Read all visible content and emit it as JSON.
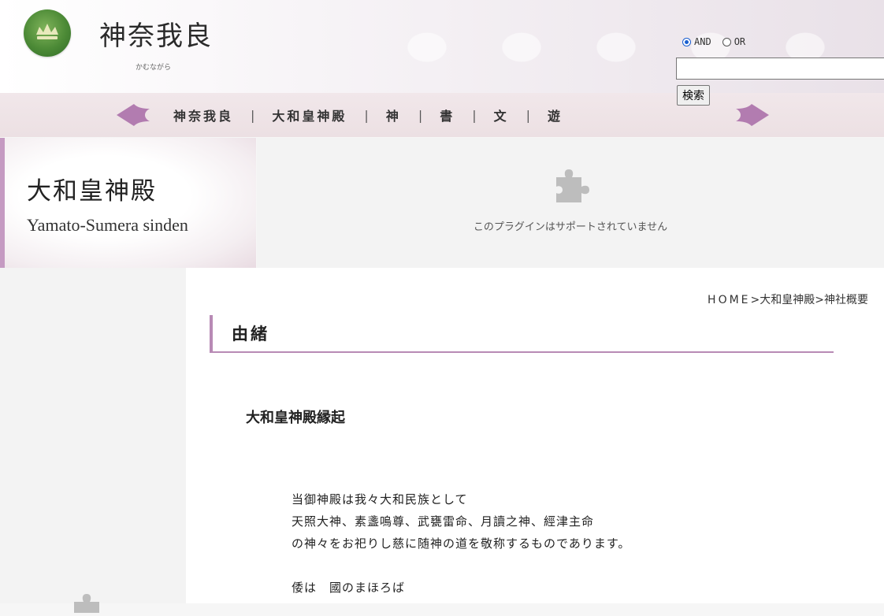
{
  "header": {
    "site_title": "神奈我良",
    "site_subtitle": "かむながら",
    "logo_icon": "crown-emblem-icon"
  },
  "search": {
    "options": [
      {
        "label": "AND",
        "checked": true
      },
      {
        "label": "OR",
        "checked": false
      }
    ],
    "input_value": "",
    "button_label": "検索"
  },
  "nav": {
    "items": [
      "神奈我良",
      "大和皇神殿",
      "神",
      "書",
      "文",
      "遊"
    ],
    "separator": "|",
    "left_arrow_icon": "arrow-left-icon",
    "right_arrow_icon": "arrow-right-icon"
  },
  "banner": {
    "title": "大和皇神殿",
    "subtitle": "Yamato-Sumera sinden",
    "plugin_message": "このプラグインはサポートされていません",
    "plugin_icon": "puzzle-piece-icon"
  },
  "colors": {
    "accent": "#b88ab5",
    "nav_bg": "#efe4e7",
    "logo_green": "#4c8a36"
  },
  "breadcrumb": {
    "home": "HOME",
    "sep": ">",
    "parent": "大和皇神殿",
    "current": "神社概要"
  },
  "section": {
    "heading": "由緒",
    "article_title": "大和皇神殿縁起",
    "paragraphs": [
      [
        "当御神殿は我々大和民族として",
        "天照大神、素盞嗚尊、武甕雷命、月讀之神、經津主命",
        "の神々をお祀りし慈に随神の道を敬称するものであります。"
      ],
      [
        "倭は　國のまほろば"
      ]
    ]
  }
}
